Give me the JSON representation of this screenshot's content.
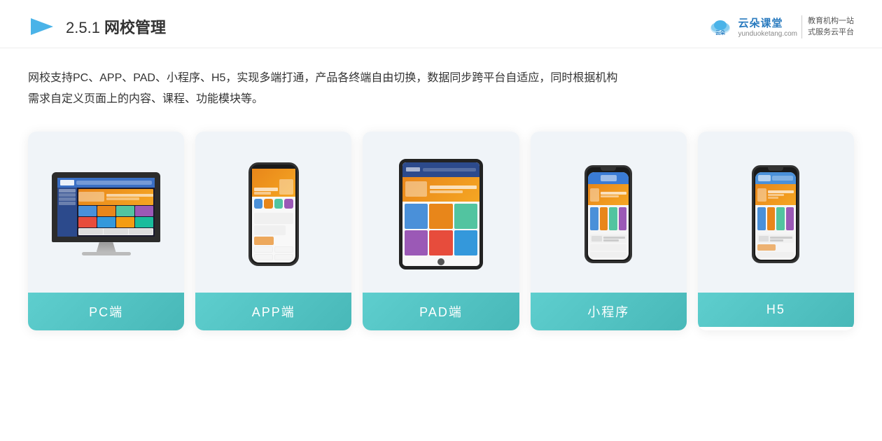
{
  "header": {
    "title_prefix": "2.5.1 ",
    "title_main": "网校管理",
    "brand": {
      "name": "云朵课堂",
      "url": "yunduoketang.com",
      "slogan_line1": "教育机构一站",
      "slogan_line2": "式服务云平台"
    }
  },
  "description": {
    "text_line1": "网校支持PC、APP、PAD、小程序、H5，实现多端打通，产品各终端自由切换，数据同步跨平台自适应，同时根据机构",
    "text_line2": "需求自定义页面上的内容、课程、功能模块等。"
  },
  "cards": [
    {
      "id": "pc",
      "label": "PC端"
    },
    {
      "id": "app",
      "label": "APP端"
    },
    {
      "id": "pad",
      "label": "PAD端"
    },
    {
      "id": "miniprogram",
      "label": "小程序"
    },
    {
      "id": "h5",
      "label": "H5"
    }
  ]
}
